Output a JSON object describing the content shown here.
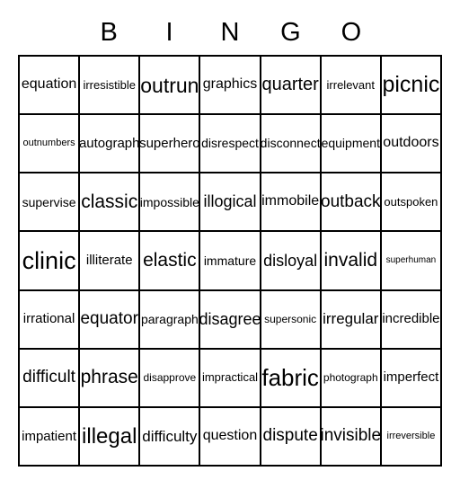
{
  "card": {
    "title": "BINGO",
    "columns": 7,
    "rows": 7,
    "ink_color": "#000000",
    "background_color": "#ffffff"
  },
  "header": {
    "letters": [
      "",
      "B",
      "I",
      "N",
      "G",
      "O",
      ""
    ]
  },
  "grid": {
    "rows": [
      {
        "cells": [
          {
            "text": "equation",
            "size": 16
          },
          {
            "text": "irresistible",
            "size": 13
          },
          {
            "text": "outrun",
            "size": 23
          },
          {
            "text": "graphics",
            "size": 16
          },
          {
            "text": "quarter",
            "size": 20
          },
          {
            "text": "irrelevant",
            "size": 13
          },
          {
            "text": "picnic",
            "size": 25
          }
        ]
      },
      {
        "cells": [
          {
            "text": "outnumbers",
            "size": 11
          },
          {
            "text": "autograph",
            "size": 15
          },
          {
            "text": "superhero",
            "size": 15
          },
          {
            "text": "disrespect",
            "size": 14
          },
          {
            "text": "disconnect",
            "size": 14
          },
          {
            "text": "equipment",
            "size": 14
          },
          {
            "text": "outdoors",
            "size": 16
          }
        ]
      },
      {
        "cells": [
          {
            "text": "supervise",
            "size": 14
          },
          {
            "text": "classic",
            "size": 21
          },
          {
            "text": "impossible",
            "size": 14
          },
          {
            "text": "illogical",
            "size": 18
          },
          {
            "text": "immobile",
            "size": 16
          },
          {
            "text": "outback",
            "size": 19
          },
          {
            "text": "outspoken",
            "size": 13
          }
        ]
      },
      {
        "cells": [
          {
            "text": "clinic",
            "size": 27
          },
          {
            "text": "illiterate",
            "size": 15
          },
          {
            "text": "elastic",
            "size": 21
          },
          {
            "text": "immature",
            "size": 14
          },
          {
            "text": "disloyal",
            "size": 18
          },
          {
            "text": "invalid",
            "size": 21
          },
          {
            "text": "superhuman",
            "size": 10
          }
        ]
      },
      {
        "cells": [
          {
            "text": "irrational",
            "size": 15
          },
          {
            "text": "equator",
            "size": 19
          },
          {
            "text": "paragraph",
            "size": 14
          },
          {
            "text": "disagree",
            "size": 18
          },
          {
            "text": "supersonic",
            "size": 12
          },
          {
            "text": "irregular",
            "size": 17
          },
          {
            "text": "incredible",
            "size": 15
          }
        ]
      },
      {
        "cells": [
          {
            "text": "difficult",
            "size": 19
          },
          {
            "text": "phrase",
            "size": 21
          },
          {
            "text": "disapprove",
            "size": 12
          },
          {
            "text": "impractical",
            "size": 13
          },
          {
            "text": "fabric",
            "size": 26
          },
          {
            "text": "photograph",
            "size": 12
          },
          {
            "text": "imperfect",
            "size": 15
          }
        ]
      },
      {
        "cells": [
          {
            "text": "impatient",
            "size": 15
          },
          {
            "text": "illegal",
            "size": 24
          },
          {
            "text": "difficulty",
            "size": 17
          },
          {
            "text": "question",
            "size": 16
          },
          {
            "text": "dispute",
            "size": 19
          },
          {
            "text": "invisible",
            "size": 19
          },
          {
            "text": "irreversible",
            "size": 11
          }
        ]
      }
    ]
  }
}
